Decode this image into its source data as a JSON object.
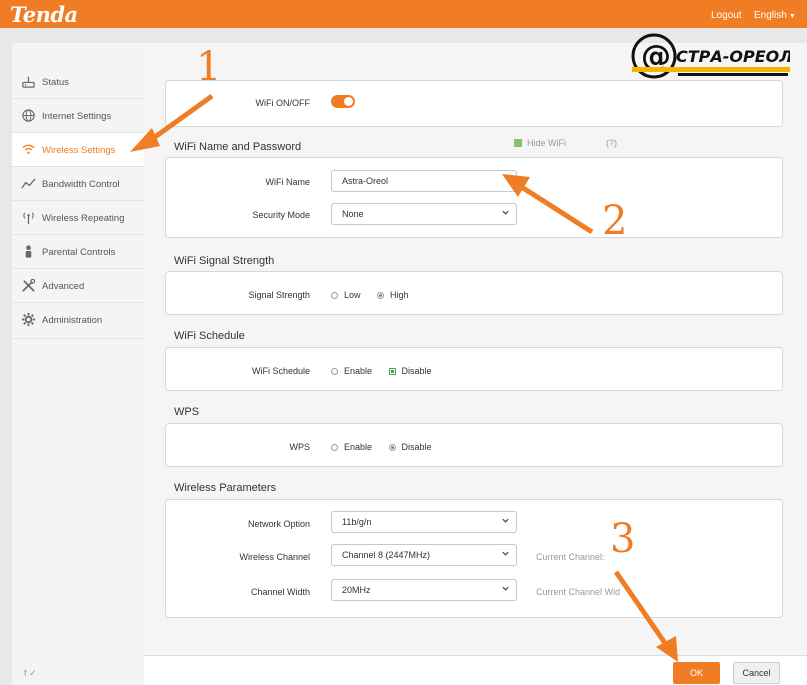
{
  "brand": {
    "logo": "Tenda"
  },
  "header": {
    "logout": "Logout",
    "language": "English"
  },
  "sidebar": {
    "items": [
      {
        "label": "Status",
        "icon": "router-icon"
      },
      {
        "label": "Internet Settings",
        "icon": "globe-icon"
      },
      {
        "label": "Wireless Settings",
        "icon": "wifi-icon",
        "active": true
      },
      {
        "label": "Bandwidth Control",
        "icon": "chart-icon"
      },
      {
        "label": "Wireless Repeating",
        "icon": "antenna-icon"
      },
      {
        "label": "Parental Controls",
        "icon": "person-icon"
      },
      {
        "label": "Advanced",
        "icon": "tools-icon"
      },
      {
        "label": "Administration",
        "icon": "gear-icon"
      }
    ],
    "social": "f  ✓"
  },
  "wifi_onoff": {
    "label": "WiFi ON/OFF",
    "on": true
  },
  "name_password": {
    "title": "WiFi Name and Password",
    "wifi_name_label": "WiFi Name",
    "wifi_name_value": "Astra-Oreol",
    "hide_wifi": "Hide WiFi",
    "help": "(?)",
    "security_label": "Security Mode",
    "security_value": "None"
  },
  "signal": {
    "title": "WiFi Signal Strength",
    "label": "Signal Strength",
    "options": [
      "Low",
      "High"
    ],
    "selected": "High"
  },
  "schedule": {
    "title": "WiFi Schedule",
    "label": "WiFi Schedule",
    "options": [
      "Enable",
      "Disable"
    ],
    "selected": "Disable"
  },
  "wps": {
    "title": "WPS",
    "label": "WPS",
    "options": [
      "Enable",
      "Disable"
    ],
    "selected": "Disable"
  },
  "wireless_params": {
    "title": "Wireless Parameters",
    "network_option_label": "Network Option",
    "network_option_value": "11b/g/n",
    "channel_label": "Wireless Channel",
    "channel_value": "Channel 8 (2447MHz)",
    "current_channel": "Current Channel:",
    "width_label": "Channel Width",
    "width_value": "20MHz",
    "current_width": "Current Channel Wid"
  },
  "footer": {
    "ok": "OK",
    "cancel": "Cancel"
  },
  "watermark": {
    "text": "СТРА-ОРЕОЛ",
    "at": "@"
  },
  "annotations": [
    "1",
    "2",
    "3"
  ],
  "colors": {
    "accent": "#f07d24",
    "check_green": "#4aa64a"
  }
}
